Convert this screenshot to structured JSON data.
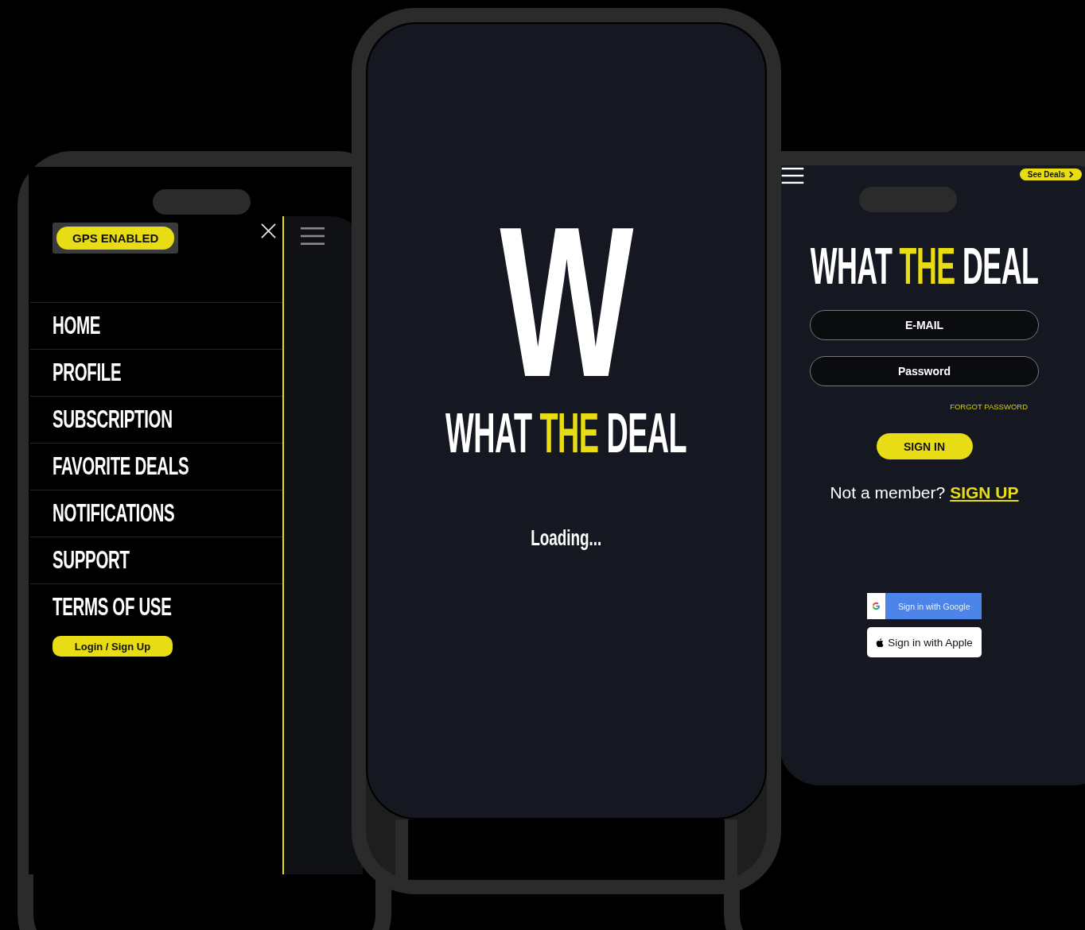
{
  "menu_phone": {
    "gps_badge": "GPS ENABLED",
    "menu_items": [
      {
        "label": "HOME"
      },
      {
        "label": "PROFILE"
      },
      {
        "label": "SUBSCRIPTION"
      },
      {
        "label": "FAVORITE DEALS"
      },
      {
        "label": "NOTIFICATIONS"
      },
      {
        "label": "SUPPORT"
      },
      {
        "label": "TERMS OF USE"
      }
    ],
    "login_button": "Login / Sign Up"
  },
  "splash_phone": {
    "logo_letter": "W",
    "logo_words": [
      {
        "text": "WHAT",
        "accent": false
      },
      {
        "text": "THE",
        "accent": true
      },
      {
        "text": "DEAL",
        "accent": false
      }
    ],
    "status": "Loading..."
  },
  "login_phone": {
    "see_deals": "See Deals",
    "logo_words": [
      {
        "text": "WHAT",
        "accent": false
      },
      {
        "text": "THE",
        "accent": true
      },
      {
        "text": "DEAL",
        "accent": false
      }
    ],
    "email_placeholder": "E-MAIL",
    "password_placeholder": "Password",
    "forgot_password": "FORGOT PASSWORD",
    "sign_in": "SIGN IN",
    "member_prompt": "Not a member?",
    "sign_up": "SIGN UP",
    "google_button": "Sign in with Google",
    "apple_button": "Sign in with Apple"
  }
}
